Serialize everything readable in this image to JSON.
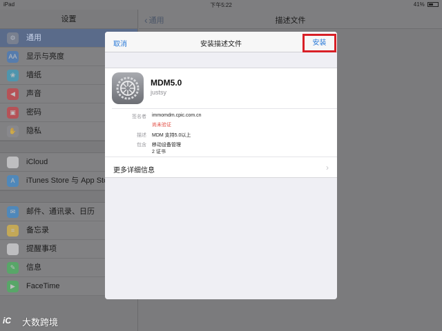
{
  "status_bar": {
    "device": "iPad",
    "time": "下午5:22",
    "battery": "41%"
  },
  "sidebar": {
    "title": "设置",
    "groups": [
      [
        {
          "label": "通用",
          "icon": "gear-icon",
          "color": "#8e8e93",
          "selected": true
        },
        {
          "label": "显示与亮度",
          "icon": "text-size-icon",
          "color": "#3b7ac9"
        },
        {
          "label": "墙纸",
          "icon": "wallpaper-icon",
          "color": "#2fa3c9"
        },
        {
          "label": "声音",
          "icon": "speaker-icon",
          "color": "#d9343b"
        },
        {
          "label": "密码",
          "icon": "lock-icon",
          "color": "#d9343b"
        },
        {
          "label": "隐私",
          "icon": "hand-icon",
          "color": "#8e8e93"
        }
      ],
      [
        {
          "label": "iCloud",
          "icon": "cloud-icon",
          "color": "#e7e7ea"
        },
        {
          "label": "iTunes Store 与 App Store",
          "icon": "app-store-icon",
          "color": "#2f8de0"
        }
      ],
      [
        {
          "label": "邮件、通讯录、日历",
          "icon": "mail-icon",
          "color": "#2f8de0"
        },
        {
          "label": "备忘录",
          "icon": "notes-icon",
          "color": "#f0c23a"
        },
        {
          "label": "提醒事项",
          "icon": "reminders-icon",
          "color": "#e7e7ea"
        },
        {
          "label": "信息",
          "icon": "messages-icon",
          "color": "#3dc057"
        },
        {
          "label": "FaceTime",
          "icon": "facetime-icon",
          "color": "#3dc057"
        }
      ]
    ]
  },
  "detail_nav": {
    "back_label": "通用",
    "title": "描述文件"
  },
  "modal": {
    "cancel_label": "取消",
    "title": "安装描述文件",
    "install_label": "安装",
    "profile": {
      "name": "MDM5.0",
      "subtitle": "justsy",
      "signer_key": "签名者",
      "signer_value": "immomdm.cpic.com.cn",
      "verification": "尚未验证",
      "description_key": "描述",
      "description_value": "MDM 支持5.0以上",
      "contains_key": "包含",
      "contains_value": "移动设备管理",
      "contains_extra": "2 证书"
    },
    "more_details": "更多详细信息"
  },
  "watermark": {
    "logo": "iC",
    "text": "大数跨境"
  },
  "colors": {
    "accent": "#2a7ad8",
    "highlight": "#d81f26",
    "warning": "#e24b41"
  }
}
